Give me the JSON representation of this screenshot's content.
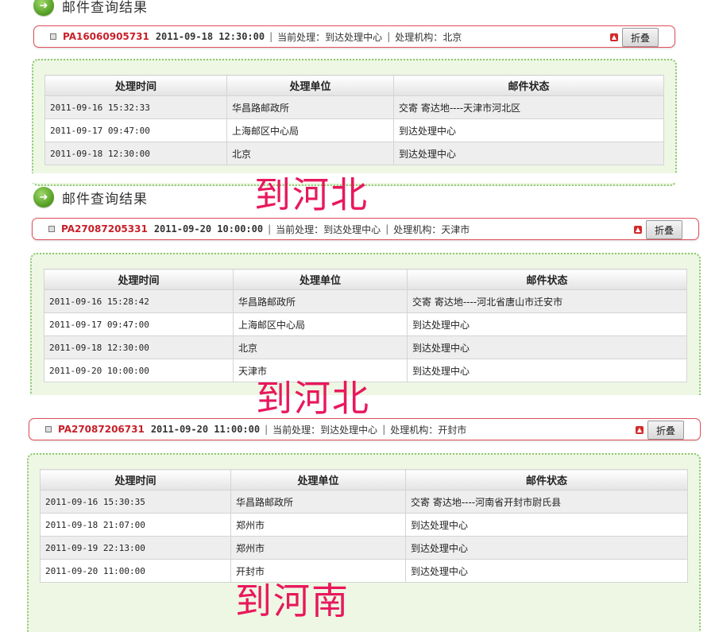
{
  "section_title": "邮件查询结果",
  "col_headers": [
    "处理时间",
    "处理单位",
    "邮件状态"
  ],
  "fold_label": "折叠",
  "current_label": "当前处理：",
  "org_label": "处理机构：",
  "sep": "|",
  "results": [
    {
      "mail_no": "PA16060905731",
      "time": "2011-09-18 12:30:00",
      "current": "到达处理中心",
      "org": "北京",
      "rows": [
        [
          "2011-09-16 15:32:33",
          "华昌路邮政所",
          "交寄 寄达地----天津市河北区"
        ],
        [
          "2011-09-17 09:47:00",
          "上海邮区中心局",
          "到达处理中心"
        ],
        [
          "2011-09-18 12:30:00",
          "北京",
          "到达处理中心"
        ]
      ],
      "annotation": "到河北"
    },
    {
      "mail_no": "PA27087205331",
      "time": "2011-09-20 10:00:00",
      "current": "到达处理中心",
      "org": "天津市",
      "rows": [
        [
          "2011-09-16 15:28:42",
          "华昌路邮政所",
          "交寄 寄达地----河北省唐山市迁安市"
        ],
        [
          "2011-09-17 09:47:00",
          "上海邮区中心局",
          "到达处理中心"
        ],
        [
          "2011-09-18 12:30:00",
          "北京",
          "到达处理中心"
        ],
        [
          "2011-09-20 10:00:00",
          "天津市",
          "到达处理中心"
        ]
      ],
      "annotation": "到河北"
    },
    {
      "mail_no": "PA27087206731",
      "time": "2011-09-20 11:00:00",
      "current": "到达处理中心",
      "org": "开封市",
      "rows": [
        [
          "2011-09-16 15:30:35",
          "华昌路邮政所",
          "交寄 寄达地----河南省开封市尉氏县"
        ],
        [
          "2011-09-18 21:07:00",
          "郑州市",
          "到达处理中心"
        ],
        [
          "2011-09-19 22:13:00",
          "郑州市",
          "到达处理中心"
        ],
        [
          "2011-09-20 11:00:00",
          "开封市",
          "到达处理中心"
        ]
      ],
      "annotation": "到河南"
    }
  ]
}
